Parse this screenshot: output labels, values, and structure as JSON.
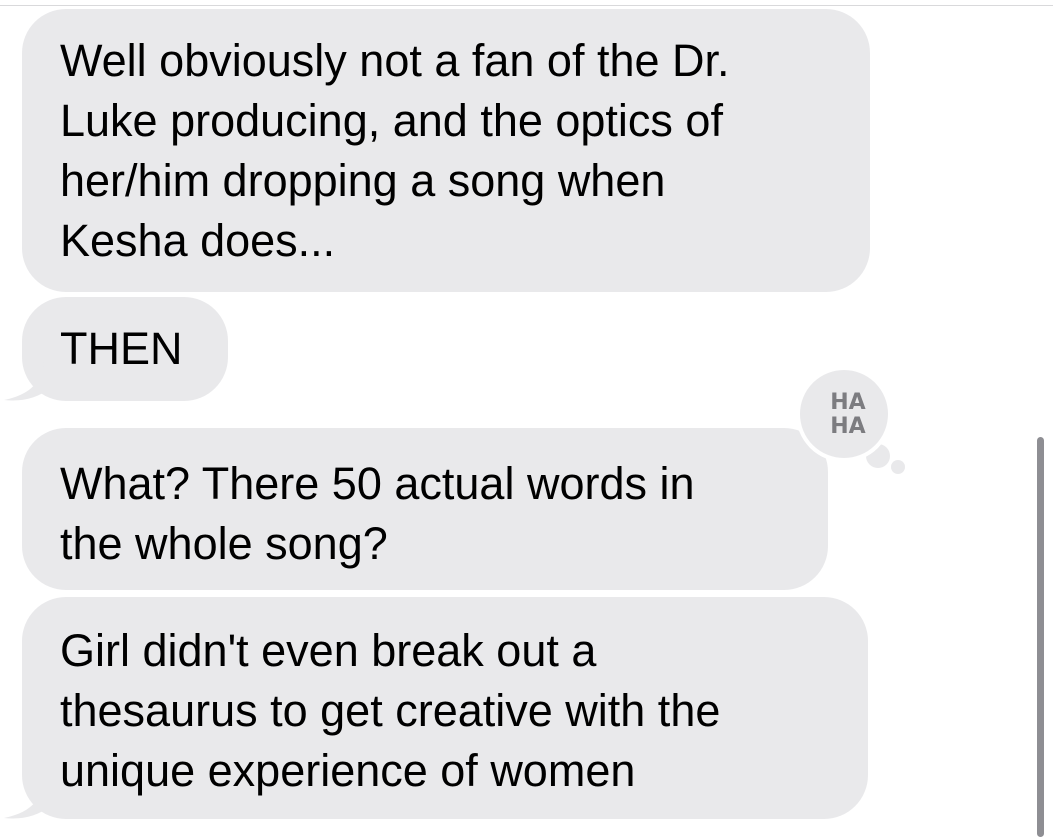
{
  "messages": [
    {
      "sender": "incoming",
      "text": "Well obviously not a fan of the Dr.\nLuke producing, and the optics of\nher/him dropping a song when\nKesha does..."
    },
    {
      "sender": "incoming",
      "text": "THEN"
    },
    {
      "sender": "incoming",
      "text": "What? There 50 actual words in\nthe whole song?",
      "tapback": {
        "icon": "haha-icon",
        "line1": "HA",
        "line2": "HA"
      }
    },
    {
      "sender": "incoming",
      "text": "Girl didn't even break out a\nthesaurus to get creative with the\nunique experience of women"
    }
  ],
  "colors": {
    "bubble_incoming": "#e9e9eb",
    "tapback_text": "#7c7c80",
    "scrollbar": "#8e8e93",
    "background": "#ffffff"
  }
}
